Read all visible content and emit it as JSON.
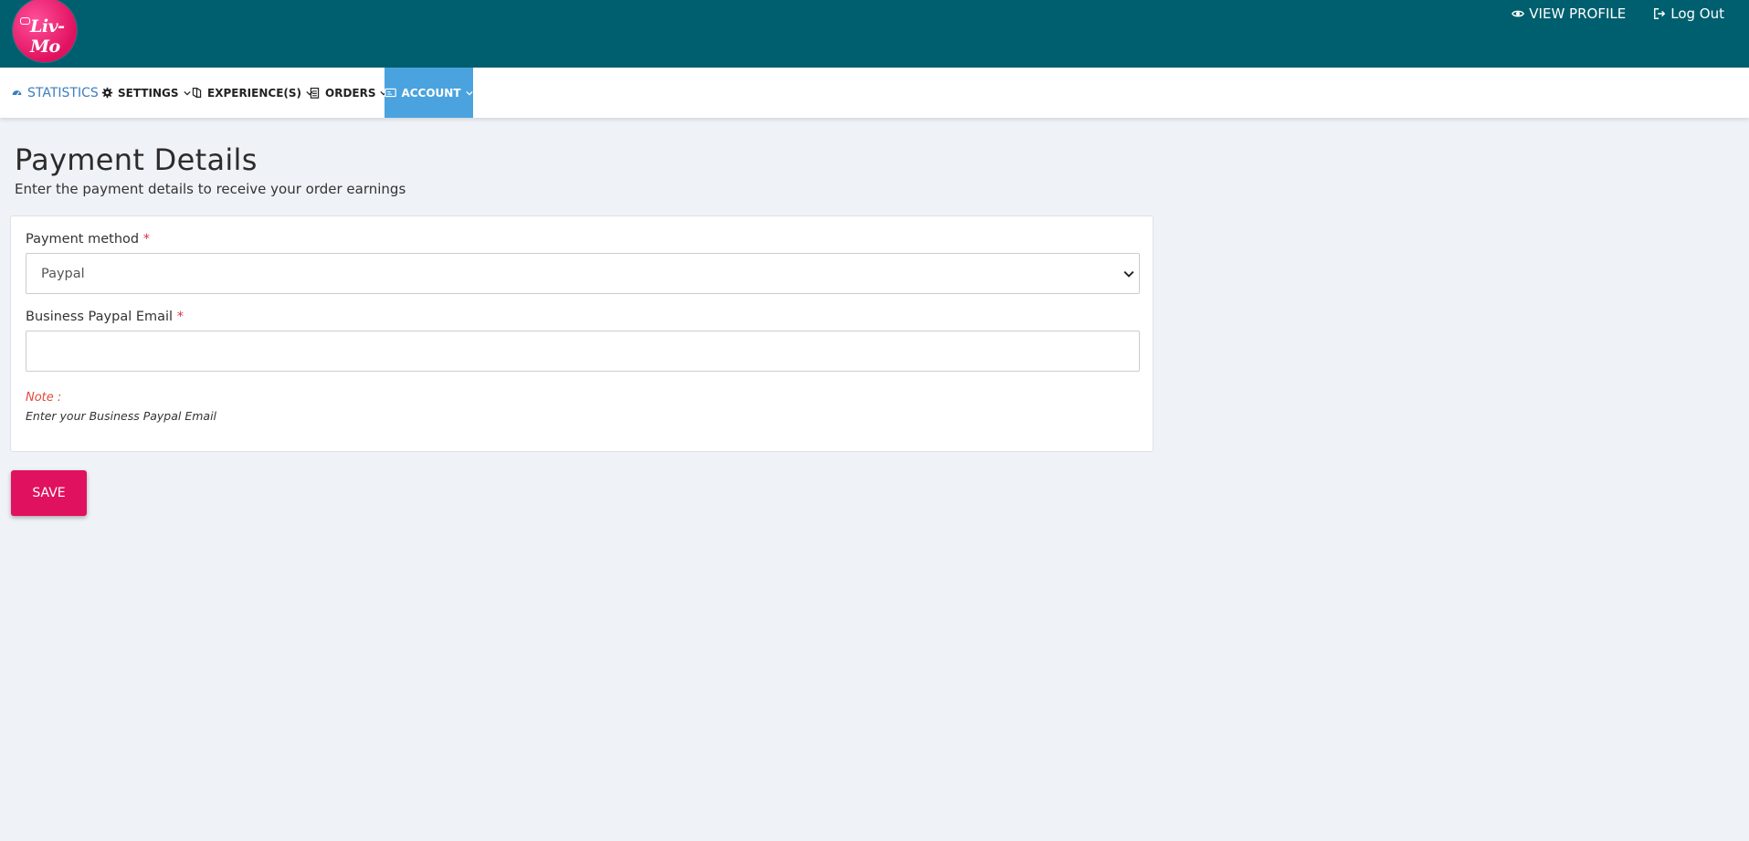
{
  "brand": {
    "logo_text": "Liv-Mo",
    "accent": "#e0115f",
    "header_bg": "#005f6e"
  },
  "header": {
    "view_profile": "VIEW PROFILE",
    "log_out": "Log Out"
  },
  "nav": {
    "statistics": "STATISTICS",
    "settings": "SETTINGS",
    "experiences": "EXPERIENCE(S)",
    "orders": "ORDERS",
    "account": "ACCOUNT",
    "active": "account",
    "active_color": "#4aa3df"
  },
  "page": {
    "title": "Payment Details",
    "subtitle": "Enter the payment details to receive your order earnings"
  },
  "form": {
    "payment_method_label": "Payment method",
    "payment_method_value": "Paypal",
    "email_label": "Business Paypal Email",
    "email_value": "",
    "required_mark": "*",
    "note_label": "Note :",
    "note_text": "Enter your Business Paypal Email"
  },
  "actions": {
    "save_label": "SAVE"
  },
  "icons": {
    "view_profile": "eye-icon",
    "log_out": "sign-out-icon",
    "statistics": "dashboard-gauge-icon",
    "settings": "gear-icon",
    "experiences": "book-icon",
    "orders": "clipboard-icon",
    "account": "id-card-icon"
  }
}
